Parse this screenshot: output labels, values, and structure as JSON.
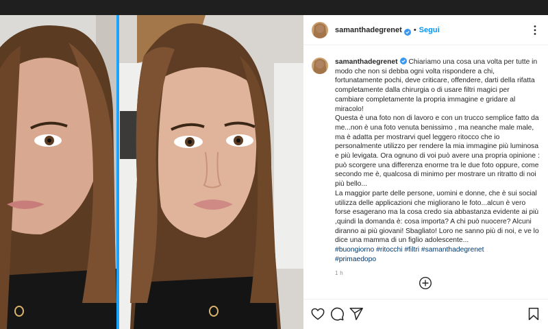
{
  "post": {
    "username": "samanthadegrenet",
    "follow_label": "Segui",
    "dot": "•",
    "caption_lines": [
      "Chiariamo una cosa una volta per tutte in modo che non si debba ogni volta rispondere a chi, fortunatamente pochi, deve criticare, offendere, darti della rifatta completamente dalla chirurgia o di usare filtri magici per cambiare completamente la propria immagine e gridare al miracolo!",
      "Questa è una foto non di lavoro e con un trucco semplice fatto da me...non è una foto venuta benissimo , ma neanche male male, ma è adatta per mostrarvi quel leggero ritocco che io personalmente utilizzo per rendere la mia immagine più luminosa e più levigata. Ora ognuno di voi può avere una propria opinione : può scorgere una differenza enorme tra le due foto oppure, come secondo me è, qualcosa di minimo per mostrare un ritratto di noi più bello...",
      "La maggior parte delle persone, uomini e donne, che è sui social utilizza delle applicazioni che migliorano le foto...alcun è vero forse esagerano ma la cosa credo sia abbastanza evidente ai più ,quindi la domanda è: cosa importa? A chi può nuocere? Alcuni diranno ai più giovani! Sbagliato! Loro ne sanno più di noi, e ve lo dice una mamma di un figlio adolescente..."
    ],
    "hashtags_line1": "#buongiorno #ritocchi #filtri #samanthadegrenet",
    "hashtags_line2": "#primaedopo",
    "time": "1 h"
  },
  "icons": {
    "verified": "verified-badge-icon",
    "more": "more-options-icon",
    "add_comment": "add-comment-plus-icon",
    "like": "heart-icon",
    "comment": "comment-bubble-icon",
    "share": "paper-plane-icon",
    "save": "bookmark-icon"
  },
  "colors": {
    "follow": "#0095f6",
    "hashtag": "#00376b",
    "verified": "#3897f0",
    "divider": "#1aa3ff"
  }
}
